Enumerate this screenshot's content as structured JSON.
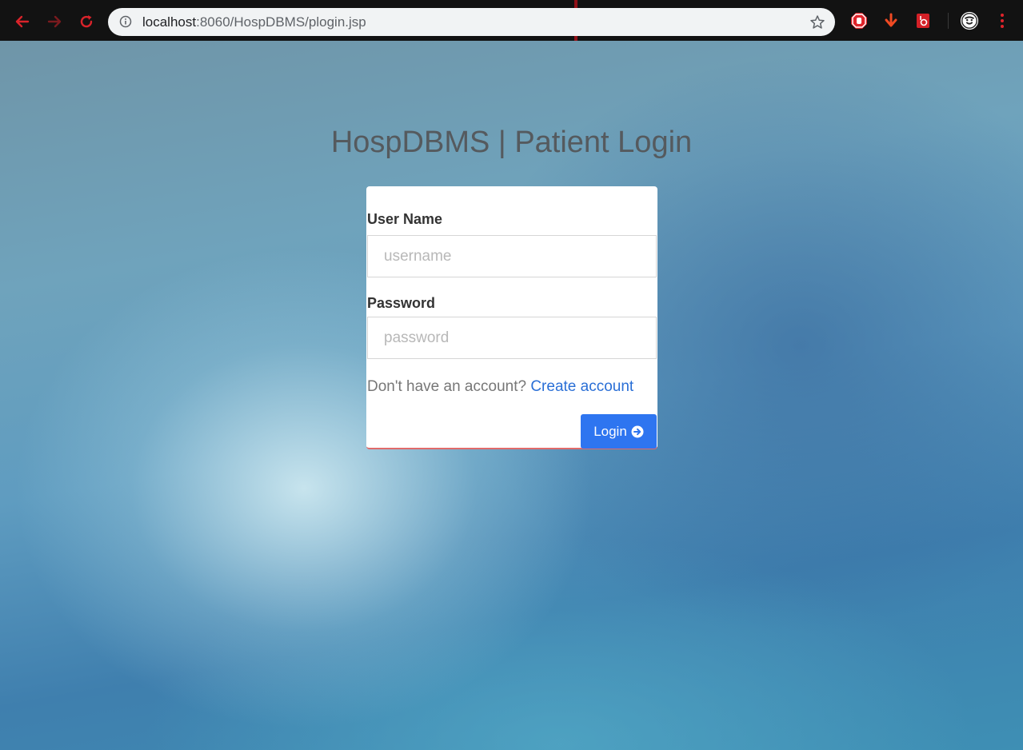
{
  "browser": {
    "url_host": "localhost",
    "url_rest": ":8060/HospDBMS/plogin.jsp",
    "icons": [
      "back-icon",
      "forward-icon",
      "reload-icon",
      "info-icon",
      "star-icon",
      "adblock-icon",
      "download-icon",
      "extension-icon",
      "profile-avatar-icon",
      "menu-icon"
    ]
  },
  "page": {
    "title": "HospDBMS | Patient Login"
  },
  "form": {
    "username_label": "User Name",
    "username_placeholder": "username",
    "password_label": "Password",
    "password_placeholder": "password",
    "account_prompt": "Don't have an account?",
    "create_account_label": "Create account",
    "login_label": "Login"
  },
  "colors": {
    "login_button": "#2e75f0",
    "link": "#2a6fd6",
    "card_accent": "#e06b6b"
  }
}
